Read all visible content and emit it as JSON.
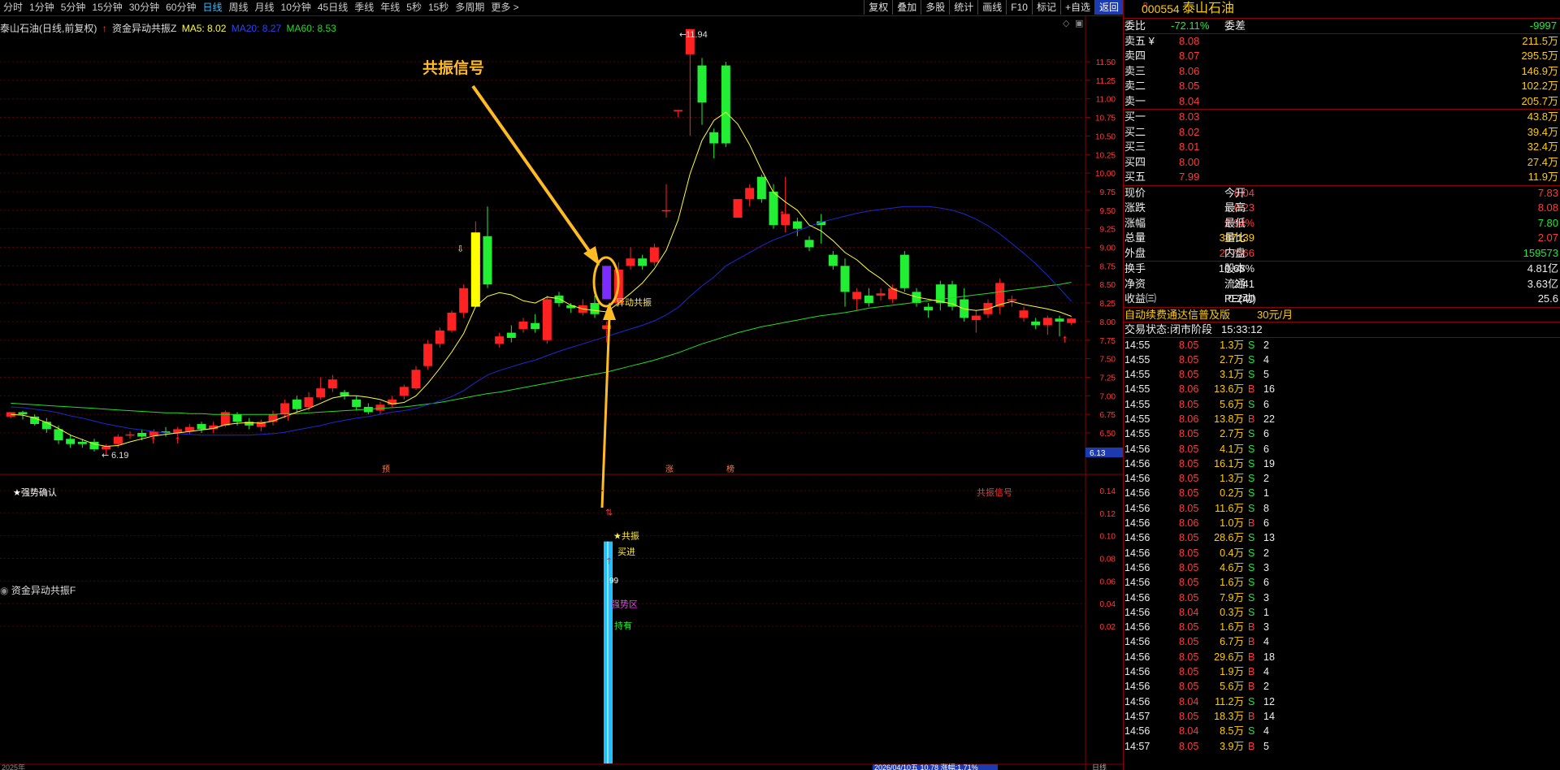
{
  "periods": [
    "分时",
    "1分钟",
    "5分钟",
    "15分钟",
    "30分钟",
    "60分钟",
    "日线",
    "周线",
    "月线",
    "10分钟",
    "45日线",
    "季线",
    "年线",
    "5秒",
    "15秒",
    "多周期",
    "更多 >"
  ],
  "active_period": "日线",
  "tools": [
    "复权",
    "叠加",
    "多股",
    "统计",
    "画线",
    "F10",
    "标记",
    "+自选",
    "返回"
  ],
  "legend": {
    "stock": "泰山石油(日线,前复权)",
    "indicator": "资金异动共振Z",
    "ma5": "MA5: 8.02",
    "ma20": "MA20: 8.27",
    "ma60": "MA60: 8.53"
  },
  "annotations": {
    "signal_title": "共振信号",
    "abnormal": "异动共振",
    "high_label": "11.94",
    "low_label": "6.19",
    "tag_pre": "预",
    "tag_zhang": "涨",
    "tag_bang": "榜",
    "star_confirm": "★强势确认",
    "sub_signal": "共振信号",
    "resonate": "★共振",
    "buy_in": "买进",
    "num99": "99",
    "strong_zone": "强势区",
    "hold": "持有",
    "price_tag": "6.13",
    "status_bottom": "2026/04/10五 10.78 涨幅:1.71%",
    "bottom_year": "2025年",
    "bottom_right": "日线"
  },
  "sub_title": "资金异动共振F",
  "y_axis": [
    "11.50",
    "11.25",
    "11.00",
    "10.75",
    "10.50",
    "10.25",
    "10.00",
    "9.75",
    "9.50",
    "9.25",
    "9.00",
    "8.75",
    "8.50",
    "8.25",
    "8.00",
    "7.75",
    "7.50",
    "7.25",
    "7.00",
    "6.75",
    "6.50"
  ],
  "sub_axis": [
    "0.14",
    "0.12",
    "0.10",
    "0.08",
    "0.06",
    "0.04",
    "0.02"
  ],
  "quote": {
    "code": "000554",
    "name": "泰山石油",
    "weibi_label": "委比",
    "weibi": "-72.11%",
    "weicha_label": "委差",
    "weicha": "-9997",
    "asks": [
      {
        "l": "卖五 ¥",
        "p": "8.08",
        "v": "211.5万"
      },
      {
        "l": "卖四",
        "p": "8.07",
        "v": "295.5万"
      },
      {
        "l": "卖三",
        "p": "8.06",
        "v": "146.9万"
      },
      {
        "l": "卖二",
        "p": "8.05",
        "v": "102.2万"
      },
      {
        "l": "卖一",
        "p": "8.04",
        "v": "205.7万"
      }
    ],
    "bids": [
      {
        "l": "买一",
        "p": "8.03",
        "v": "43.8万"
      },
      {
        "l": "买二",
        "p": "8.02",
        "v": "39.4万"
      },
      {
        "l": "买三",
        "p": "8.01",
        "v": "32.4万"
      },
      {
        "l": "买四",
        "p": "8.00",
        "v": "27.4万"
      },
      {
        "l": "买五",
        "p": "7.99",
        "v": "11.9万"
      }
    ],
    "stats": [
      {
        "l1": "现价",
        "v1": "8.04",
        "c1": "red",
        "l2": "今开",
        "v2": "7.83",
        "c2": "red"
      },
      {
        "l1": "涨跌",
        "v1": "0.23",
        "c1": "red",
        "l2": "最高",
        "v2": "8.08",
        "c2": "red"
      },
      {
        "l1": "涨幅",
        "v1": "2.94%",
        "c1": "red",
        "l2": "最低",
        "v2": "7.80",
        "c2": "green"
      },
      {
        "l1": "总量",
        "v1": "387139",
        "c1": "yellow",
        "l2": "量比",
        "v2": "2.07",
        "c2": "red"
      },
      {
        "l1": "外盘",
        "v1": "227566",
        "c1": "red",
        "l2": "内盘",
        "v2": "159573",
        "c2": "green"
      }
    ],
    "stats2": [
      {
        "l1": "换手",
        "v1": "10.68%",
        "l2": "股本",
        "v2": "4.81亿"
      },
      {
        "l1": "净资",
        "v1": "2.41",
        "l2": "流通",
        "v2": "3.63亿"
      },
      {
        "l1": "收益㈢",
        "v1": "0.240",
        "l2": "PE(动)",
        "v2": "25.6"
      }
    ],
    "promo": "自动续费通达信普及版",
    "promo_price": "30元/月",
    "trade_state_label": "交易状态:",
    "trade_state": "闭市阶段",
    "trade_time": "15:33:12"
  },
  "ticks": [
    [
      "14:55",
      "8.05",
      "1.3万",
      "S",
      "2"
    ],
    [
      "14:55",
      "8.05",
      "2.7万",
      "S",
      "4"
    ],
    [
      "14:55",
      "8.05",
      "3.1万",
      "S",
      "5"
    ],
    [
      "14:55",
      "8.06",
      "13.6万",
      "B",
      "16"
    ],
    [
      "14:55",
      "8.05",
      "5.6万",
      "S",
      "6"
    ],
    [
      "14:55",
      "8.06",
      "13.8万",
      "B",
      "22"
    ],
    [
      "14:55",
      "8.05",
      "2.7万",
      "S",
      "6"
    ],
    [
      "14:56",
      "8.05",
      "4.1万",
      "S",
      "6"
    ],
    [
      "14:56",
      "8.05",
      "16.1万",
      "S",
      "19"
    ],
    [
      "14:56",
      "8.05",
      "1.3万",
      "S",
      "2"
    ],
    [
      "14:56",
      "8.05",
      "0.2万",
      "S",
      "1"
    ],
    [
      "14:56",
      "8.05",
      "11.6万",
      "S",
      "8"
    ],
    [
      "14:56",
      "8.06",
      "1.0万",
      "B",
      "6"
    ],
    [
      "14:56",
      "8.05",
      "28.6万",
      "S",
      "13"
    ],
    [
      "14:56",
      "8.05",
      "0.4万",
      "S",
      "2"
    ],
    [
      "14:56",
      "8.05",
      "4.6万",
      "S",
      "3"
    ],
    [
      "14:56",
      "8.05",
      "1.6万",
      "S",
      "6"
    ],
    [
      "14:56",
      "8.05",
      "7.9万",
      "S",
      "3"
    ],
    [
      "14:56",
      "8.04",
      "0.3万",
      "S",
      "1"
    ],
    [
      "14:56",
      "8.05",
      "1.6万",
      "B",
      "3"
    ],
    [
      "14:56",
      "8.05",
      "6.7万",
      "B",
      "4"
    ],
    [
      "14:56",
      "8.05",
      "29.6万",
      "B",
      "18"
    ],
    [
      "14:56",
      "8.05",
      "1.9万",
      "B",
      "4"
    ],
    [
      "14:56",
      "8.05",
      "5.6万",
      "B",
      "2"
    ],
    [
      "14:56",
      "8.04",
      "11.2万",
      "S",
      "12"
    ],
    [
      "14:57",
      "8.05",
      "18.3万",
      "B",
      "14"
    ],
    [
      "14:56",
      "8.04",
      "8.5万",
      "S",
      "4"
    ],
    [
      "14:57",
      "8.05",
      "3.9万",
      "B",
      "5"
    ]
  ],
  "chart_data": {
    "type": "candlestick",
    "y_range": [
      6.0,
      12.0
    ],
    "candles": [
      [
        6.72,
        6.78,
        6.7,
        6.75
      ],
      [
        6.78,
        6.75,
        6.68,
        6.8
      ],
      [
        6.72,
        6.62,
        6.6,
        6.75
      ],
      [
        6.65,
        6.55,
        6.5,
        6.7
      ],
      [
        6.55,
        6.4,
        6.35,
        6.6
      ],
      [
        6.42,
        6.35,
        6.3,
        6.48
      ],
      [
        6.38,
        6.35,
        6.3,
        6.42
      ],
      [
        6.38,
        6.28,
        6.25,
        6.42
      ],
      [
        6.28,
        6.32,
        6.19,
        6.35
      ],
      [
        6.35,
        6.45,
        6.3,
        6.48
      ],
      [
        6.48,
        6.48,
        6.42,
        6.52
      ],
      [
        6.5,
        6.45,
        6.4,
        6.55
      ],
      [
        6.46,
        6.52,
        6.42,
        6.55
      ],
      [
        6.52,
        6.5,
        6.45,
        6.58
      ],
      [
        6.5,
        6.55,
        6.45,
        6.58
      ],
      [
        6.52,
        6.58,
        6.48,
        6.62
      ],
      [
        6.62,
        6.55,
        6.5,
        6.65
      ],
      [
        6.55,
        6.6,
        6.5,
        6.65
      ],
      [
        6.6,
        6.78,
        6.58,
        6.8
      ],
      [
        6.75,
        6.65,
        6.6,
        6.78
      ],
      [
        6.65,
        6.6,
        6.55,
        6.7
      ],
      [
        6.58,
        6.65,
        6.52,
        6.68
      ],
      [
        6.65,
        6.75,
        6.6,
        6.8
      ],
      [
        6.75,
        6.9,
        6.7,
        6.95
      ],
      [
        6.95,
        6.82,
        6.78,
        7.0
      ],
      [
        6.85,
        6.98,
        6.8,
        7.05
      ],
      [
        6.98,
        7.1,
        6.95,
        7.25
      ],
      [
        7.1,
        7.22,
        7.05,
        7.28
      ],
      [
        7.05,
        7.0,
        6.95,
        7.08
      ],
      [
        6.95,
        6.85,
        6.8,
        7.0
      ],
      [
        6.85,
        6.78,
        6.75,
        6.9
      ],
      [
        6.8,
        6.88,
        6.75,
        6.92
      ],
      [
        6.88,
        6.95,
        6.85,
        7.0
      ],
      [
        7.0,
        7.12,
        6.95,
        7.15
      ],
      [
        7.1,
        7.35,
        7.08,
        7.4
      ],
      [
        7.4,
        7.7,
        7.35,
        7.75
      ],
      [
        7.7,
        7.88,
        7.65,
        7.92
      ],
      [
        7.88,
        8.12,
        7.85,
        8.15
      ],
      [
        8.12,
        8.45,
        8.05,
        8.5
      ],
      [
        8.3,
        9.2,
        8.25,
        9.35
      ],
      [
        9.15,
        8.5,
        8.45,
        9.55
      ],
      [
        7.7,
        7.8,
        7.65,
        7.85
      ],
      [
        7.85,
        7.78,
        7.72,
        7.95
      ],
      [
        7.9,
        8.0,
        7.85,
        8.05
      ],
      [
        7.98,
        7.9,
        7.85,
        8.1
      ],
      [
        7.75,
        8.3,
        7.7,
        8.35
      ],
      [
        8.35,
        8.25,
        8.2,
        8.4
      ],
      [
        8.22,
        8.18,
        8.12,
        8.25
      ],
      [
        8.12,
        8.22,
        8.08,
        8.3
      ],
      [
        8.25,
        8.1,
        8.05,
        8.35
      ],
      [
        7.9,
        7.95,
        7.72,
        8.0
      ],
      [
        8.25,
        8.7,
        8.2,
        8.8
      ],
      [
        8.75,
        8.85,
        8.7,
        9.0
      ],
      [
        8.85,
        8.75,
        8.7,
        8.9
      ],
      [
        8.8,
        9.0,
        8.75,
        9.05
      ],
      [
        9.5,
        9.5,
        9.4,
        9.85
      ],
      [
        10.85,
        10.85,
        10.75,
        10.85
      ],
      [
        11.6,
        11.94,
        10.5,
        11.94
      ],
      [
        11.45,
        10.95,
        10.65,
        11.55
      ],
      [
        10.55,
        10.4,
        10.2,
        10.6
      ],
      [
        11.45,
        10.4,
        10.35,
        11.5
      ],
      [
        9.4,
        9.65,
        9.4,
        9.65
      ],
      [
        9.65,
        9.8,
        9.55,
        9.85
      ],
      [
        9.95,
        9.65,
        9.6,
        9.98
      ],
      [
        9.75,
        9.3,
        9.25,
        9.85
      ],
      [
        9.3,
        9.45,
        9.2,
        9.95
      ],
      [
        9.35,
        9.25,
        9.15,
        9.4
      ],
      [
        9.1,
        9.0,
        8.95,
        9.15
      ],
      [
        9.35,
        9.3,
        9.05,
        9.45
      ],
      [
        8.9,
        8.75,
        8.7,
        8.95
      ],
      [
        8.75,
        8.4,
        8.2,
        8.85
      ],
      [
        8.3,
        8.4,
        8.15,
        8.45
      ],
      [
        8.35,
        8.25,
        8.2,
        8.45
      ],
      [
        8.35,
        8.38,
        8.28,
        8.45
      ],
      [
        8.3,
        8.45,
        8.25,
        8.5
      ],
      [
        8.9,
        8.45,
        8.4,
        8.95
      ],
      [
        8.4,
        8.25,
        8.2,
        8.45
      ],
      [
        8.2,
        8.15,
        8.05,
        8.25
      ],
      [
        8.5,
        8.25,
        8.15,
        8.55
      ],
      [
        8.5,
        8.2,
        8.15,
        8.55
      ],
      [
        8.3,
        8.05,
        8.0,
        8.45
      ],
      [
        8.02,
        8.08,
        7.85,
        8.15
      ],
      [
        8.1,
        8.25,
        8.05,
        8.3
      ],
      [
        8.2,
        8.52,
        8.1,
        8.58
      ],
      [
        8.28,
        8.3,
        8.2,
        8.35
      ],
      [
        8.05,
        8.15,
        8.0,
        8.2
      ],
      [
        8.0,
        7.95,
        7.9,
        8.05
      ],
      [
        7.95,
        8.05,
        7.82,
        8.08
      ],
      [
        8.04,
        8.0,
        7.8,
        8.08
      ],
      [
        7.98,
        8.04,
        7.95,
        8.05
      ]
    ],
    "ma5": [
      6.75,
      6.74,
      6.7,
      6.64,
      6.56,
      6.47,
      6.41,
      6.35,
      6.32,
      6.33,
      6.38,
      6.42,
      6.46,
      6.48,
      6.5,
      6.52,
      6.54,
      6.56,
      6.61,
      6.63,
      6.64,
      6.63,
      6.66,
      6.72,
      6.78,
      6.83,
      6.9,
      6.97,
      7.0,
      7.0,
      6.98,
      6.95,
      6.89,
      6.91,
      7.0,
      7.17,
      7.37,
      7.59,
      7.84,
      8.2,
      8.34,
      8.39,
      8.36,
      8.28,
      8.25,
      8.33,
      8.31,
      8.22,
      8.17,
      8.15,
      8.13,
      8.25,
      8.38,
      8.52,
      8.71,
      8.96,
      9.37,
      9.99,
      10.44,
      10.71,
      10.82,
      10.66,
      10.38,
      10.04,
      9.74,
      9.61,
      9.5,
      9.3,
      9.22,
      9.09,
      8.93,
      8.83,
      8.69,
      8.58,
      8.44,
      8.38,
      8.33,
      8.3,
      8.27,
      8.24,
      8.17,
      8.15,
      8.17,
      8.23,
      8.27,
      8.23,
      8.2,
      8.17,
      8.13,
      8.07
    ],
    "ma20": [
      6.85,
      6.84,
      6.82,
      6.8,
      6.77,
      6.73,
      6.7,
      6.66,
      6.62,
      6.59,
      6.56,
      6.54,
      6.52,
      6.5,
      6.49,
      6.48,
      6.47,
      6.47,
      6.47,
      6.47,
      6.47,
      6.48,
      6.49,
      6.51,
      6.54,
      6.57,
      6.6,
      6.64,
      6.67,
      6.7,
      6.72,
      6.75,
      6.78,
      6.8,
      6.83,
      6.88,
      6.93,
      6.99,
      7.07,
      7.18,
      7.28,
      7.34,
      7.39,
      7.44,
      7.48,
      7.54,
      7.6,
      7.65,
      7.7,
      7.75,
      7.8,
      7.85,
      7.9,
      7.95,
      8.01,
      8.09,
      8.19,
      8.34,
      8.48,
      8.6,
      8.75,
      8.84,
      8.93,
      9.02,
      9.1,
      9.16,
      9.22,
      9.28,
      9.34,
      9.38,
      9.42,
      9.46,
      9.49,
      9.51,
      9.53,
      9.55,
      9.55,
      9.55,
      9.53,
      9.5,
      9.45,
      9.38,
      9.29,
      9.18,
      9.05,
      8.92,
      8.78,
      8.62,
      8.45,
      8.27
    ],
    "ma60": [
      6.9,
      6.89,
      6.88,
      6.87,
      6.86,
      6.85,
      6.84,
      6.83,
      6.82,
      6.81,
      6.8,
      6.79,
      6.78,
      6.77,
      6.77,
      6.76,
      6.76,
      6.75,
      6.75,
      6.75,
      6.75,
      6.75,
      6.75,
      6.76,
      6.76,
      6.77,
      6.78,
      6.79,
      6.8,
      6.81,
      6.82,
      6.83,
      6.84,
      6.85,
      6.87,
      6.89,
      6.91,
      6.94,
      6.97,
      7.0,
      7.03,
      7.05,
      7.08,
      7.11,
      7.14,
      7.17,
      7.2,
      7.23,
      7.26,
      7.29,
      7.32,
      7.36,
      7.4,
      7.44,
      7.48,
      7.53,
      7.58,
      7.64,
      7.7,
      7.75,
      7.8,
      7.85,
      7.89,
      7.93,
      7.96,
      7.99,
      8.02,
      8.05,
      8.08,
      8.1,
      8.12,
      8.15,
      8.18,
      8.2,
      8.22,
      8.24,
      8.26,
      8.28,
      8.3,
      8.32,
      8.34,
      8.36,
      8.38,
      8.4,
      8.42,
      8.44,
      8.46,
      8.48,
      8.5,
      8.53
    ]
  }
}
